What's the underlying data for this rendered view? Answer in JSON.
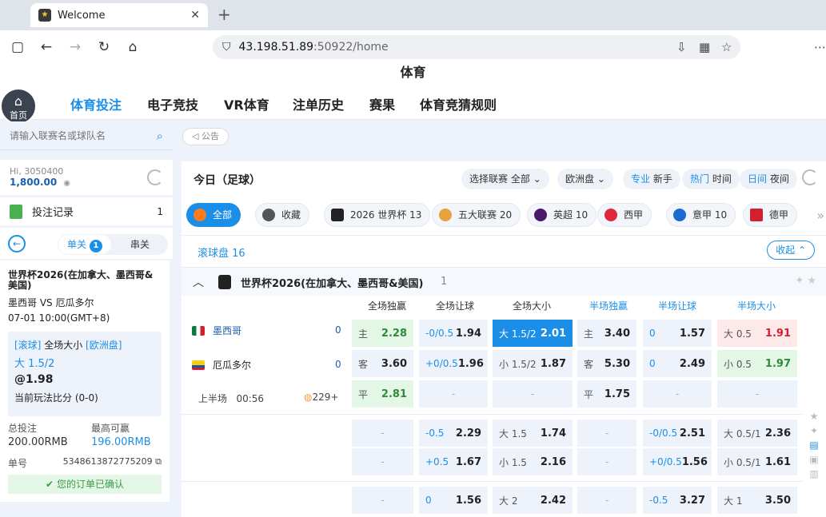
{
  "browser": {
    "tab_title": "Welcome",
    "url_host": "43.198.51.89",
    "url_rest": ":50922/home"
  },
  "site": {
    "title": "体育",
    "home_label": "首页",
    "nav": [
      "体育投注",
      "电子竞技",
      "VR体育",
      "注单历史",
      "赛果",
      "体育竞猜规则"
    ],
    "notice_label": "公告"
  },
  "sidebar": {
    "search_placeholder": "请输入联赛名或球队名",
    "greeting": "Hi, 3050400",
    "balance": "1,800.00",
    "records_label": "投注记录",
    "records_count": "1",
    "seg_single": "单关",
    "seg_single_count": "1",
    "seg_parlay": "串关"
  },
  "slip": {
    "league": "世界杯2026(在加拿大、墨西哥&美国)",
    "match": "墨西哥 VS 厄瓜多尔",
    "time": "07-01 10:00(GMT+8)",
    "live_tag": "[滚球]",
    "market": "全场大小",
    "odds_type": "[欧洲盘]",
    "selection": "大 1.5/2",
    "odds": "@1.98",
    "score_note": "当前玩法比分 (0-0)",
    "stake_label": "总投注",
    "stake": "200.00RMB",
    "max_win_label": "最高可赢",
    "max_win": "196.00RMB",
    "order_label": "单号",
    "order_no": "5348613872775209",
    "confirmed": "您的订单已确认"
  },
  "filters": {
    "today": "今日（足球）",
    "league_select_label": "选择联赛",
    "league_select_value": "全部",
    "odds_format": "欧洲盘",
    "mode_pro": "专业",
    "mode_novice": "新手",
    "sort_hot": "热门",
    "sort_time": "时间",
    "view_day": "日间",
    "view_night": "夜间"
  },
  "categories": [
    {
      "label": "全部",
      "color": "#ff7a1a"
    },
    {
      "label": "收藏",
      "color": "#555555"
    },
    {
      "label": "2026 世界杯 13",
      "color": "#222222"
    },
    {
      "label": "五大联赛 20",
      "color": "#e8a23c"
    },
    {
      "label": "英超 10",
      "color": "#4b1a6b"
    },
    {
      "label": "西甲",
      "color": "#e0283a"
    },
    {
      "label": "意甲 10",
      "color": "#1b6ad0"
    },
    {
      "label": "德甲",
      "color": "#d32030"
    }
  ],
  "live": {
    "label": "滚球盘 16",
    "collapse": "收起"
  },
  "league": {
    "name": "世界杯2026(在加拿大、墨西哥&美国)",
    "count": "1"
  },
  "columns": [
    "全场独赢",
    "全场让球",
    "全场大小",
    "半场独赢",
    "半场让球",
    "半场大小"
  ],
  "match": {
    "home": "墨西哥",
    "away": "厄瓜多尔",
    "home_score": "0",
    "away_score": "0",
    "period": "上半场",
    "clock": "00:56",
    "more": "229+"
  },
  "rows": [
    {
      "c1": {
        "k": "主",
        "v": "2.28"
      },
      "c2": {
        "k": "-0/0.5",
        "v": "1.94"
      },
      "c3": {
        "k": "大 1.5/2",
        "v": "2.01"
      },
      "c4": {
        "k": "主",
        "v": "3.40"
      },
      "c5": {
        "k": "0",
        "v": "1.57"
      },
      "c6": {
        "k": "大 0.5",
        "v": "1.91"
      }
    },
    {
      "c1": {
        "k": "客",
        "v": "3.60"
      },
      "c2": {
        "k": "+0/0.5",
        "v": "1.96"
      },
      "c3": {
        "k": "小 1.5/2",
        "v": "1.87"
      },
      "c4": {
        "k": "客",
        "v": "5.30"
      },
      "c5": {
        "k": "0",
        "v": "2.49"
      },
      "c6": {
        "k": "小 0.5",
        "v": "1.97"
      }
    },
    {
      "c1": {
        "k": "平",
        "v": "2.81"
      },
      "c2": {
        "k": "-",
        "v": ""
      },
      "c3": {
        "k": "-",
        "v": ""
      },
      "c4": {
        "k": "平",
        "v": "1.75"
      },
      "c5": {
        "k": "-",
        "v": ""
      },
      "c6": {
        "k": "-",
        "v": ""
      }
    },
    {
      "c1": {
        "k": "-",
        "v": ""
      },
      "c2": {
        "k": "-0.5",
        "v": "2.29"
      },
      "c3": {
        "k": "大 1.5",
        "v": "1.74"
      },
      "c4": {
        "k": "-",
        "v": ""
      },
      "c5": {
        "k": "-0/0.5",
        "v": "2.51"
      },
      "c6": {
        "k": "大 0.5/1",
        "v": "2.36"
      }
    },
    {
      "c1": {
        "k": "-",
        "v": ""
      },
      "c2": {
        "k": "+0.5",
        "v": "1.67"
      },
      "c3": {
        "k": "小 1.5",
        "v": "2.16"
      },
      "c4": {
        "k": "-",
        "v": ""
      },
      "c5": {
        "k": "+0/0.5",
        "v": "1.56"
      },
      "c6": {
        "k": "小 0.5/1",
        "v": "1.61"
      }
    },
    {
      "c1": {
        "k": "-",
        "v": ""
      },
      "c2": {
        "k": "0",
        "v": "1.56"
      },
      "c3": {
        "k": "大 2",
        "v": "2.42"
      },
      "c4": {
        "k": "-",
        "v": ""
      },
      "c5": {
        "k": "-0.5",
        "v": "3.27"
      },
      "c6": {
        "k": "大 1",
        "v": "3.50"
      }
    }
  ]
}
